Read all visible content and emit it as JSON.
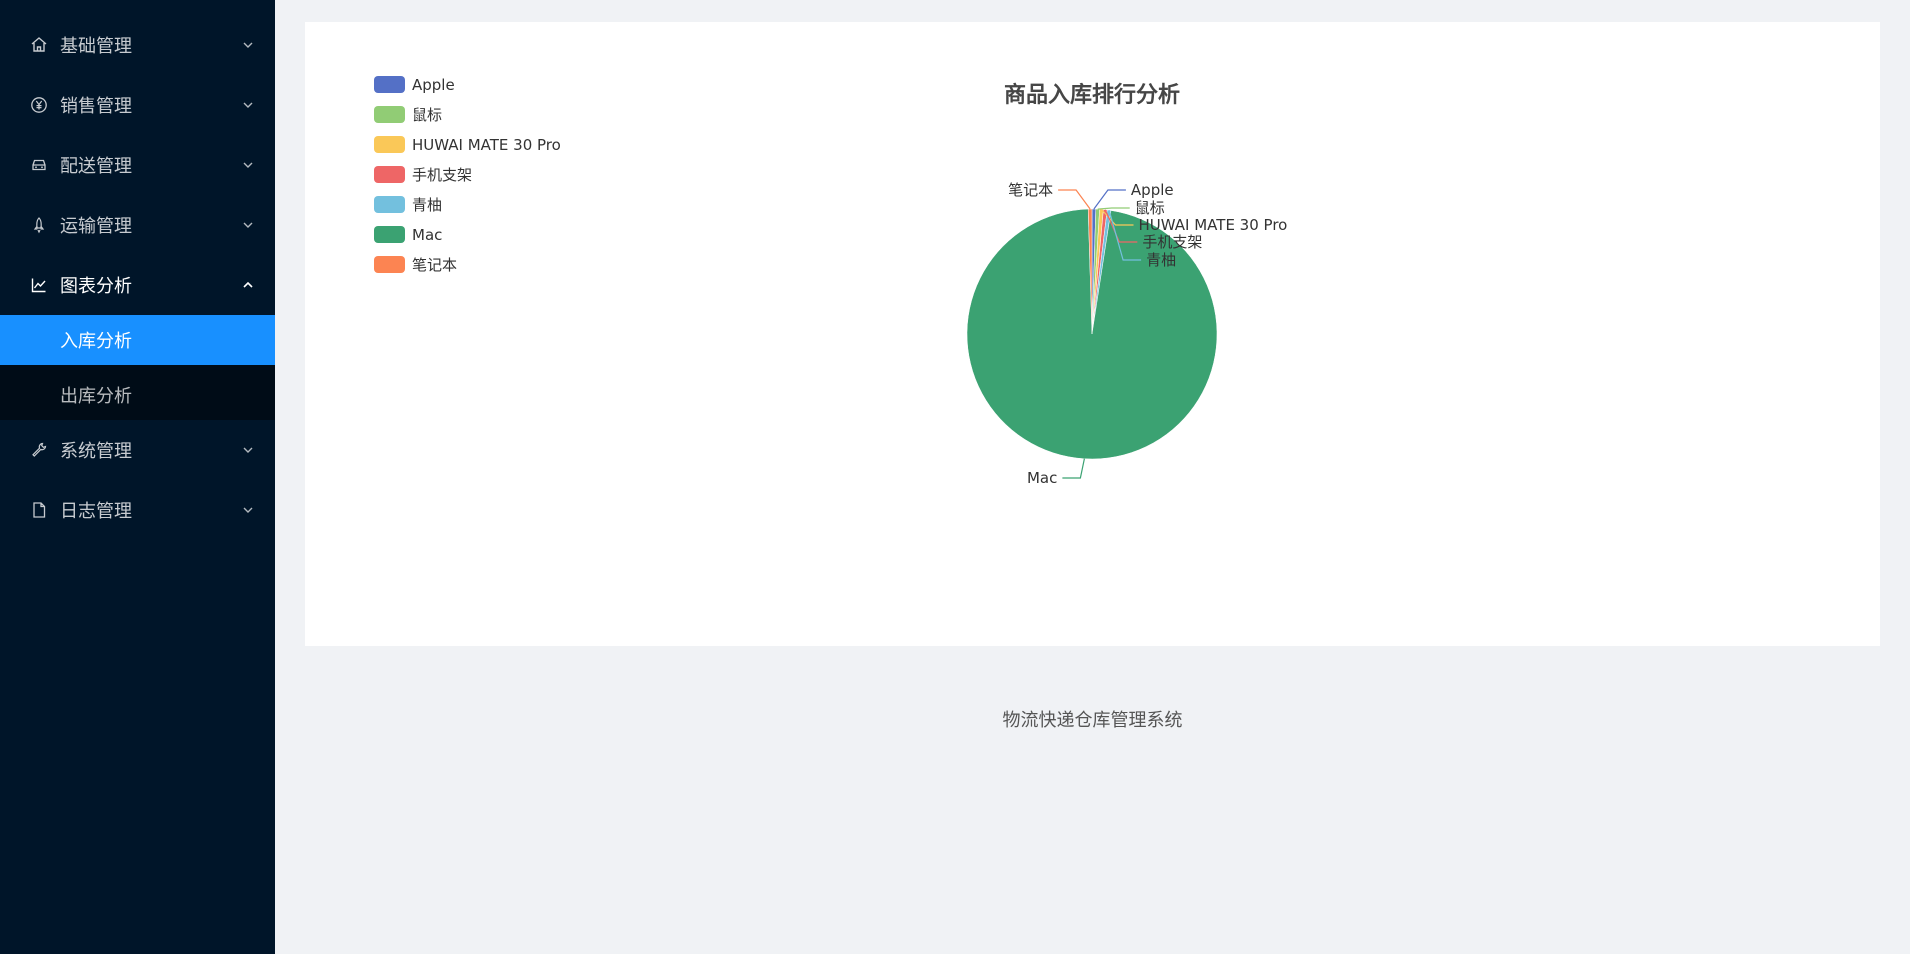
{
  "sidebar": {
    "menus": [
      {
        "label": "基础管理",
        "icon": "home-icon",
        "expanded": false
      },
      {
        "label": "销售管理",
        "icon": "yen-icon",
        "expanded": false
      },
      {
        "label": "配送管理",
        "icon": "car-icon",
        "expanded": false
      },
      {
        "label": "运输管理",
        "icon": "rocket-icon",
        "expanded": false
      },
      {
        "label": "图表分析",
        "icon": "line-chart-icon",
        "expanded": true,
        "children": [
          {
            "label": "入库分析",
            "active": true
          },
          {
            "label": "出库分析",
            "active": false
          }
        ]
      },
      {
        "label": "系统管理",
        "icon": "wrench-icon",
        "expanded": false
      },
      {
        "label": "日志管理",
        "icon": "file-icon",
        "expanded": false
      }
    ]
  },
  "chart_data": {
    "type": "pie",
    "title": "商品入库排行分析",
    "legend_position": "top-left",
    "slices": [
      {
        "name": "Apple",
        "value": 1,
        "color": "#5470c6"
      },
      {
        "name": "鼠标",
        "value": 1,
        "color": "#91cc75"
      },
      {
        "name": "HUWAI MATE 30 Pro",
        "value": 1,
        "color": "#fac858"
      },
      {
        "name": "手机支架",
        "value": 1,
        "color": "#ee6666"
      },
      {
        "name": "青柚",
        "value": 1,
        "color": "#73c0de"
      },
      {
        "name": "Mac",
        "value": 200,
        "color": "#3ba272"
      },
      {
        "name": "笔记本",
        "value": 1,
        "color": "#fc8452"
      }
    ]
  },
  "footer": {
    "text": "物流快递仓库管理系统"
  }
}
